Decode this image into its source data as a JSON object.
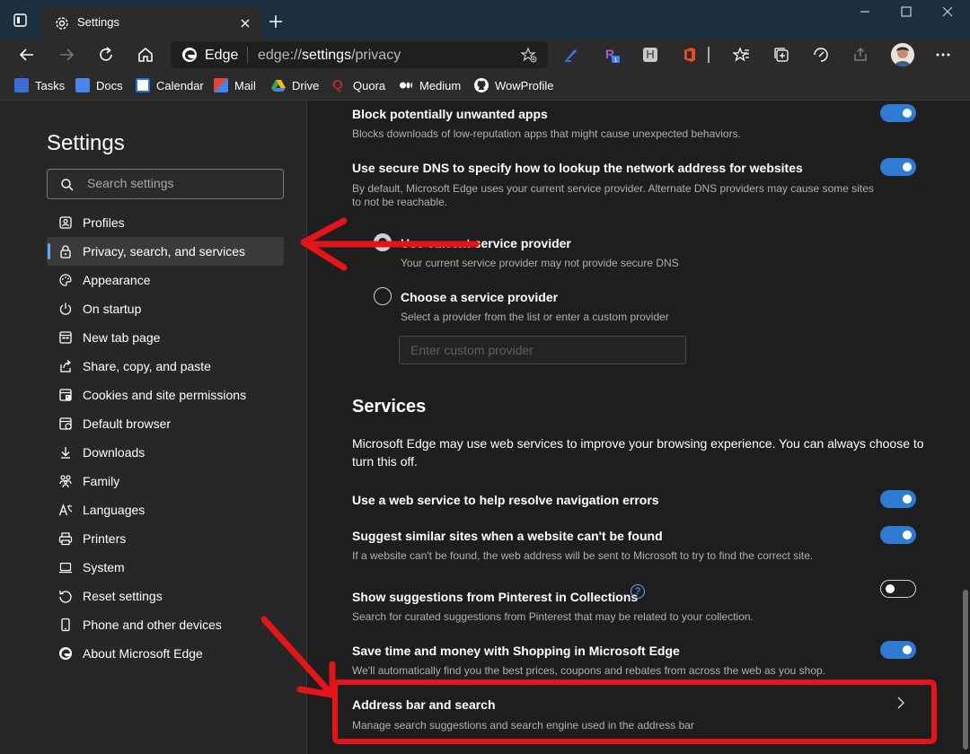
{
  "browser": {
    "tab_title": "Settings",
    "address_site": "Edge",
    "address_url_prefix": "edge://",
    "address_url_main": "settings",
    "address_url_suffix": "/privacy"
  },
  "bookmarks": [
    {
      "label": "Tasks",
      "color": "#3b6cd9"
    },
    {
      "label": "Docs",
      "color": "#4a86e8"
    },
    {
      "label": "Calendar",
      "color": "#1a73e8"
    },
    {
      "label": "Mail",
      "color": "#ea4335"
    },
    {
      "label": "Drive",
      "color": "#34a853"
    },
    {
      "label": "Quora",
      "color": "#b92b27"
    },
    {
      "label": "Medium",
      "color": "#ffffff"
    },
    {
      "label": "WowProfile",
      "color": "#ffffff"
    }
  ],
  "sidebar": {
    "title": "Settings",
    "search_placeholder": "Search settings",
    "items": [
      {
        "label": "Profiles",
        "icon": "profile-icon"
      },
      {
        "label": "Privacy, search, and services",
        "icon": "lock-icon",
        "active": true
      },
      {
        "label": "Appearance",
        "icon": "palette-icon"
      },
      {
        "label": "On startup",
        "icon": "power-icon"
      },
      {
        "label": "New tab page",
        "icon": "newtab-icon"
      },
      {
        "label": "Share, copy, and paste",
        "icon": "share-icon"
      },
      {
        "label": "Cookies and site permissions",
        "icon": "cookies-icon"
      },
      {
        "label": "Default browser",
        "icon": "browser-icon"
      },
      {
        "label": "Downloads",
        "icon": "download-icon"
      },
      {
        "label": "Family",
        "icon": "family-icon"
      },
      {
        "label": "Languages",
        "icon": "languages-icon"
      },
      {
        "label": "Printers",
        "icon": "printer-icon"
      },
      {
        "label": "System",
        "icon": "system-icon"
      },
      {
        "label": "Reset settings",
        "icon": "reset-icon"
      },
      {
        "label": "Phone and other devices",
        "icon": "phone-icon"
      },
      {
        "label": "About Microsoft Edge",
        "icon": "edge-icon"
      }
    ]
  },
  "main": {
    "block_apps": {
      "title": "Block potentially unwanted apps",
      "desc": "Blocks downloads of low-reputation apps that might cause unexpected behaviors.",
      "enabled": true
    },
    "secure_dns": {
      "title": "Use secure DNS to specify how to lookup the network address for websites",
      "desc1": "By default, Microsoft Edge uses your current service provider. Alternate DNS providers may cause some sites",
      "desc2": "to not be reachable.",
      "enabled": true
    },
    "current_provider": {
      "title": "Use current service provider",
      "desc": "Your current service provider may not provide secure DNS",
      "selected": true
    },
    "choose_provider": {
      "title": "Choose a service provider",
      "desc": "Select a provider from the list or enter a custom provider",
      "selected": false,
      "input_placeholder": "Enter custom provider"
    },
    "services": {
      "heading": "Services",
      "intro": "Microsoft Edge may use web services to improve your browsing experience. You can always choose to turn this off."
    },
    "nav_errors": {
      "title": "Use a web service to help resolve navigation errors",
      "enabled": true
    },
    "similar_sites": {
      "title": "Suggest similar sites when a website can't be found",
      "desc": "If a website can't be found, the web address will be sent to Microsoft to try to find the correct site.",
      "enabled": true
    },
    "pinterest": {
      "title": "Show suggestions from Pinterest in Collections",
      "desc": "Search for curated suggestions from Pinterest that may be related to your collection.",
      "enabled": false
    },
    "shopping": {
      "title": "Save time and money with Shopping in Microsoft Edge",
      "desc": "We'll automatically find you the best prices, coupons and rebates from across the web as you shop.",
      "enabled": true
    },
    "address_bar": {
      "title": "Address bar and search",
      "desc": "Manage search suggestions and search engine used in the address bar"
    }
  },
  "colors": {
    "accent": "#2f7bd3",
    "annotation": "#e4141b"
  }
}
